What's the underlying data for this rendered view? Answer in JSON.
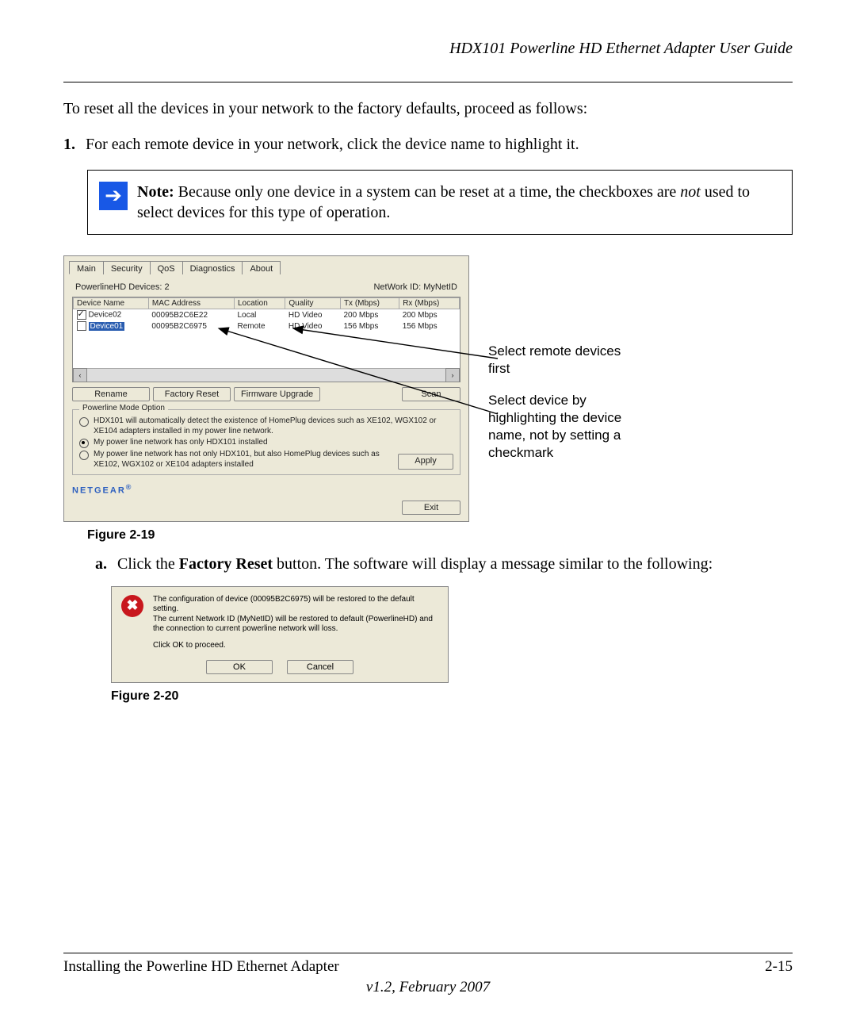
{
  "doc_title": "HDX101 Powerline HD Ethernet Adapter User Guide",
  "intro": "To reset all the devices in your network to the factory defaults, proceed as follows:",
  "step1_num": "1.",
  "step1": "For each remote device in your network, click the device name to highlight it.",
  "note_label": "Note:",
  "note_text_a": " Because only one device in a system can be reset at a time, the checkboxes are ",
  "note_text_b": "not",
  "note_text_c": " used to select devices for this type of operation.",
  "tabs": [
    "Main",
    "Security",
    "QoS",
    "Diagnostics",
    "About"
  ],
  "device_count_label": "PowerlineHD Devices: 2",
  "network_id_label": "NetWork ID: MyNetID",
  "columns": [
    "Device Name",
    "MAC Address",
    "Location",
    "Quality",
    "Tx (Mbps)",
    "Rx (Mbps)"
  ],
  "rows": [
    {
      "name": "Device02",
      "mac": "00095B2C6E22",
      "loc": "Local",
      "quality": "HD Video",
      "tx": "200 Mbps",
      "rx": "200 Mbps",
      "checked": true,
      "selected": false
    },
    {
      "name": "Device01",
      "mac": "00095B2C6975",
      "loc": "Remote",
      "quality": "HD Video",
      "tx": "156 Mbps",
      "rx": "156 Mbps",
      "checked": false,
      "selected": true
    }
  ],
  "btn_rename": "Rename",
  "btn_factory": "Factory Reset",
  "btn_firmware": "Firmware Upgrade",
  "btn_scan": "Scan",
  "mode_title": "Powerline Mode Option",
  "mode_opts": [
    "HDX101 will automatically detect the existence of HomePlug devices such as XE102, WGX102 or XE104 adapters installed in my power line network.",
    "My power line network has only HDX101 installed",
    "My power line network has not only HDX101, but also HomePlug devices such as XE102, WGX102 or XE104 adapters installed"
  ],
  "mode_selected": 1,
  "btn_apply": "Apply",
  "brand": "NETGEAR",
  "btn_exit": "Exit",
  "callout1": "Select remote devices first",
  "callout2": "Select device by highlighting the device name, not by setting a checkmark",
  "fig1": "Figure 2-19",
  "substep_a_lbl": "a.",
  "substep_a_before": "Click the ",
  "substep_a_bold": "Factory Reset",
  "substep_a_after": " button. The software will display a message similar to the following:",
  "dlg_line1": "The configuration of device (00095B2C6975) will be restored to the default setting.",
  "dlg_line2": "The current Network ID (MyNetID) will be restored to default (PowerlineHD) and the connection to current powerline network will loss.",
  "dlg_line3": "Click OK to proceed.",
  "btn_ok": "OK",
  "btn_cancel": "Cancel",
  "fig2": "Figure 2-20",
  "footer_left": "Installing the Powerline HD Ethernet Adapter",
  "footer_right": "2-15",
  "footer_ver": "v1.2, February 2007"
}
